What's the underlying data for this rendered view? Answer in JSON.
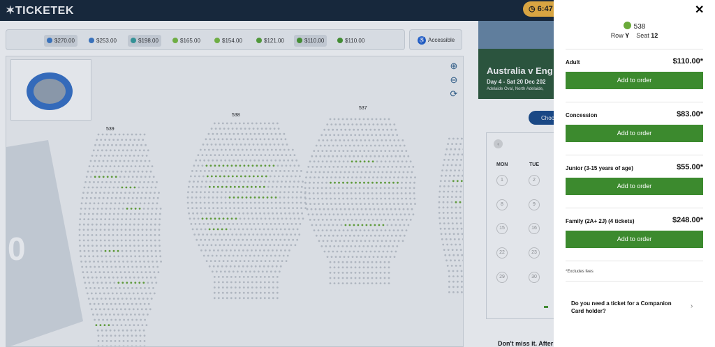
{
  "header": {
    "brand": "TICKETEK",
    "timer": "6:47"
  },
  "price_filters": [
    {
      "label": "$270.00",
      "color": "#3f7cc9",
      "selected": true
    },
    {
      "label": "$253.00",
      "color": "#3f7cc9",
      "selected": false
    },
    {
      "label": "$198.00",
      "color": "#3aa0a0",
      "selected": true
    },
    {
      "label": "$165.00",
      "color": "#7cc043",
      "selected": false
    },
    {
      "label": "$154.00",
      "color": "#7cc043",
      "selected": false
    },
    {
      "label": "$121.00",
      "color": "#5aa83a",
      "selected": false
    },
    {
      "label": "$110.00",
      "color": "#4a9a30",
      "selected": true
    },
    {
      "label": "$110.00",
      "color": "#4a9a30",
      "selected": false
    }
  ],
  "accessible_label": "Accessible",
  "seatmap": {
    "sections": [
      "539",
      "538",
      "537"
    ],
    "big_label": "0"
  },
  "event": {
    "title": "Australia v Eng",
    "date": "Day 4 - Sat 20 Dec 202",
    "venue": "Adelaide Oval, North Adelaide,"
  },
  "choose_label": "Choo",
  "calendar": {
    "days": [
      "MON",
      "TUE"
    ],
    "dates": [
      [
        "1",
        "2"
      ],
      [
        "8",
        "9"
      ],
      [
        "15",
        "16"
      ],
      [
        "22",
        "23"
      ],
      [
        "29",
        "30"
      ]
    ]
  },
  "dont_miss": "Don't miss it. After",
  "panel": {
    "section": "538",
    "section_color": "#6aaa3a",
    "row_label": "Row",
    "row": "Y",
    "seat_label": "Seat",
    "seat": "12",
    "tickets": [
      {
        "name": "Adult",
        "price": "$110.00*",
        "button": "Add to order"
      },
      {
        "name": "Concession",
        "price": "$83.00*",
        "button": "Add to order"
      },
      {
        "name": "Junior (3-15 years of age)",
        "price": "$55.00*",
        "button": "Add to order"
      },
      {
        "name": "Family (2A+ 2J) (4 tickets)",
        "price": "$248.00*",
        "button": "Add to order"
      }
    ],
    "fees_note": "*Excludes fees",
    "companion": "Do you need a ticket for a Companion Card holder?"
  },
  "colors": {
    "accent_green": "#3c8a2e",
    "header_navy": "#18283a",
    "timer_bg": "#f4b740"
  }
}
